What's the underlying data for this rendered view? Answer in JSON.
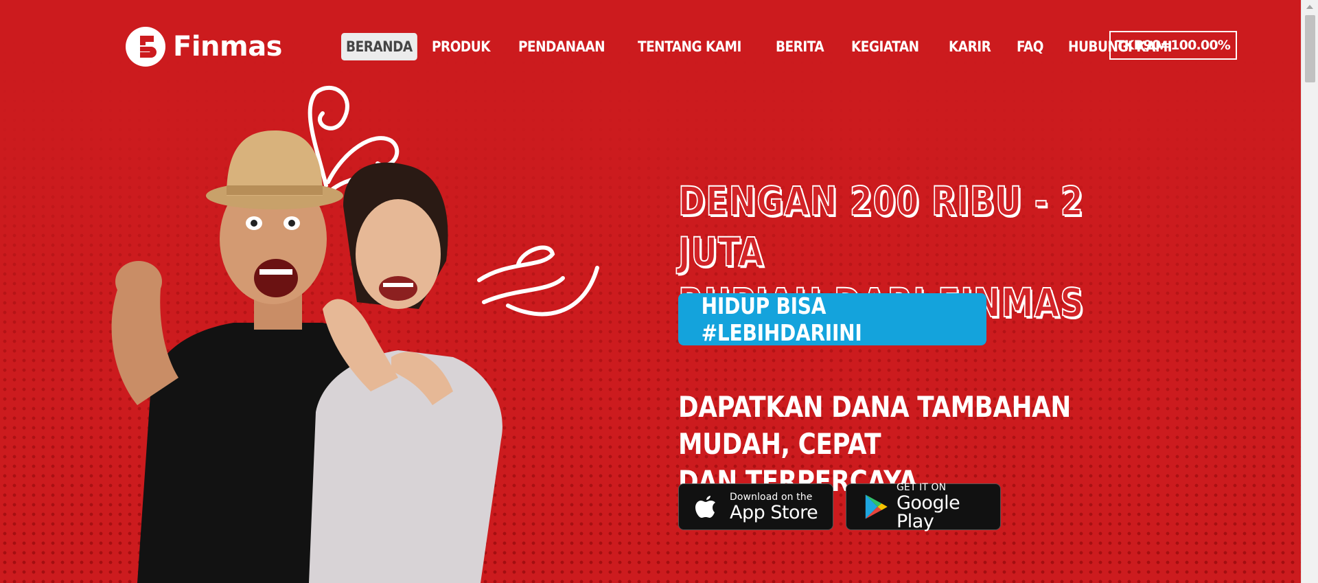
{
  "brand": {
    "name": "Finmas",
    "logo_icon": "finmas-f-icon",
    "primary_color": "#cc1b1e",
    "accent_color": "#14a3dc"
  },
  "nav": {
    "items": [
      {
        "label": "BERANDA",
        "active": true
      },
      {
        "label": "PRODUK"
      },
      {
        "label": "PENDANAAN"
      },
      {
        "label": "TENTANG KAMI"
      },
      {
        "label": "BERITA"
      },
      {
        "label": "KEGIATAN"
      },
      {
        "label": "KARIR"
      },
      {
        "label": "FAQ"
      },
      {
        "label": "HUBUNGI KAMI"
      }
    ],
    "tkb_label": "TKB90=100.00%"
  },
  "hero": {
    "title_line1": "DENGAN 200 RIBU - 2 JUTA",
    "title_line2": "RUPIAH DARI FINMAS",
    "hashtag_button": "HIDUP BISA #LEBIHDARIINI",
    "subtitle_line1": "DAPATKAN DANA TAMBAHAN MUDAH, CEPAT",
    "subtitle_line2": "DAN TERPERCAYA"
  },
  "stores": {
    "appstore": {
      "small": "Download on the",
      "big": "App Store",
      "icon": "apple-icon"
    },
    "google": {
      "small": "GET IT ON",
      "big": "Google Play",
      "icon": "google-play-icon"
    }
  }
}
